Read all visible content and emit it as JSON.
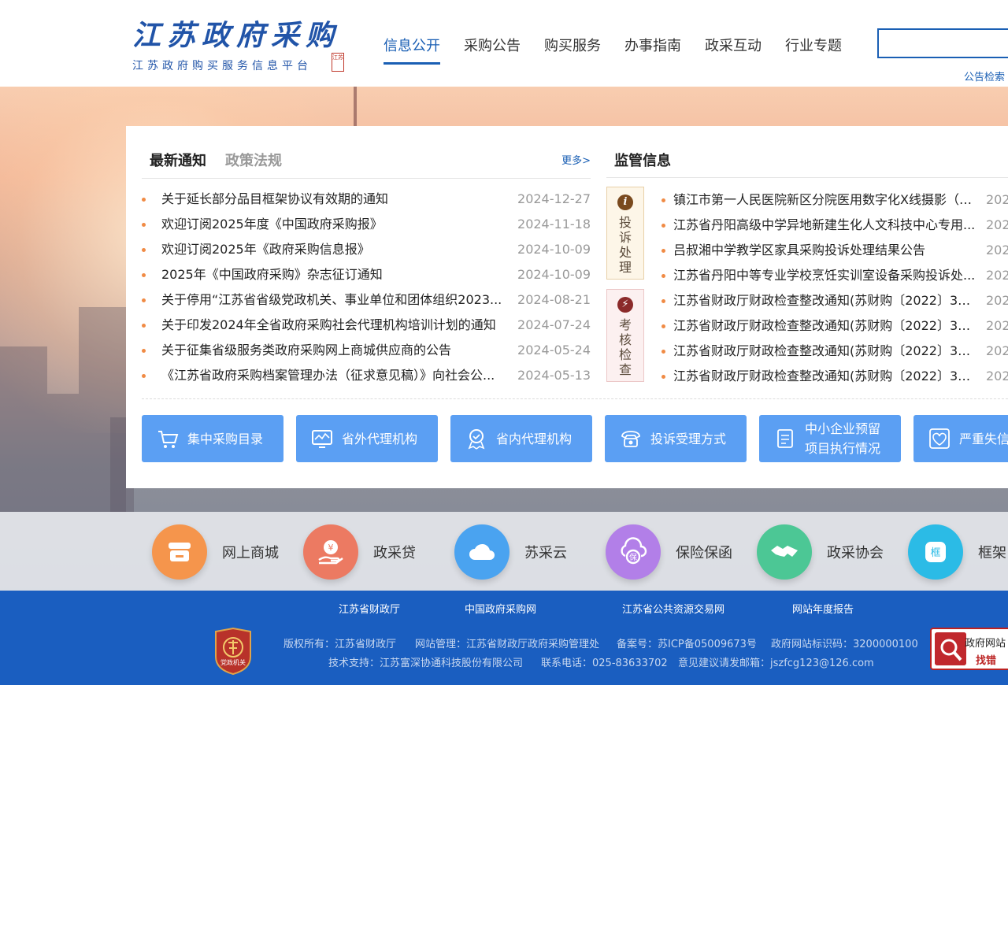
{
  "header": {
    "logo_title": "江苏政府采购",
    "logo_subtitle": "江苏政府购买服务信息平台",
    "logo_seal": "江苏",
    "nav": [
      {
        "label": "信息公开",
        "active": true
      },
      {
        "label": "采购公告"
      },
      {
        "label": "购买服务"
      },
      {
        "label": "办事指南"
      },
      {
        "label": "政采互动"
      },
      {
        "label": "行业专题"
      }
    ],
    "search": {
      "value": "",
      "placeholder": ""
    },
    "search_link": "公告检索"
  },
  "notice": {
    "tab_latest": "最新通知",
    "tab_policy": "政策法规",
    "more": "更多>",
    "items": [
      {
        "title": "关于延长部分品目框架协议有效期的通知",
        "date": "2024-12-27"
      },
      {
        "title": "欢迎订阅2025年度《中国政府采购报》",
        "date": "2024-11-18"
      },
      {
        "title": "欢迎订阅2025年《政府采购信息报》",
        "date": "2024-10-09"
      },
      {
        "title": "2025年《中国政府采购》杂志征订通知",
        "date": "2024-10-09"
      },
      {
        "title": "关于停用“江苏省省级党政机关、事业单位和团体组织2023...",
        "date": "2024-08-21"
      },
      {
        "title": "关于印发2024年全省政府采购社会代理机构培训计划的通知",
        "date": "2024-07-24"
      },
      {
        "title": "关于征集省级服务类政府采购网上商城供应商的公告",
        "date": "2024-05-24"
      },
      {
        "title": "《江苏省政府采购档案管理办法（征求意见稿）》向社会公...",
        "date": "2024-05-13"
      }
    ]
  },
  "supervise": {
    "title": "监管信息",
    "box_complaint": {
      "icon_char": "i",
      "label": "投诉处理"
    },
    "box_exam": {
      "icon_char": "⚡",
      "label": "考核检查"
    },
    "items": [
      {
        "title": "镇江市第一人民医院新区分院医用数字化X线摄影（D...",
        "date": "202"
      },
      {
        "title": "江苏省丹阳高级中学异地新建生化人文科技中心专用...",
        "date": "202"
      },
      {
        "title": "吕叔湘中学教学区家具采购投诉处理结果公告",
        "date": "202"
      },
      {
        "title": "江苏省丹阳中等专业学校烹饪实训室设备采购投诉处...",
        "date": "202"
      },
      {
        "title": "江苏省财政厅财政检查整改通知(苏财购〔2022〕37号)",
        "date": "202"
      },
      {
        "title": "江苏省财政厅财政检查整改通知(苏财购〔2022〕36号)",
        "date": "202"
      },
      {
        "title": "江苏省财政厅财政检查整改通知(苏财购〔2022〕35号)",
        "date": "202"
      },
      {
        "title": "江苏省财政厅财政检查整改通知(苏财购〔2022〕33号)",
        "date": "202"
      }
    ]
  },
  "quick_links": [
    {
      "label": "集中采购目录",
      "icon": "cart-icon"
    },
    {
      "label": "省外代理机构",
      "icon": "monitor-icon"
    },
    {
      "label": "省内代理机构",
      "icon": "badge-icon"
    },
    {
      "label": "投诉受理方式",
      "icon": "phone-icon"
    },
    {
      "label": "中小企业预留项目执行情况",
      "line1": "中小企业预留",
      "line2": "项目执行情况",
      "icon": "document-icon"
    },
    {
      "label": "严重失信",
      "icon": "heart-icon"
    }
  ],
  "services": [
    {
      "label": "网上商城",
      "icon": "shop-icon",
      "color": "#f5954c"
    },
    {
      "label": "政采贷",
      "icon": "loan-icon",
      "color": "#ec7a62"
    },
    {
      "label": "苏采云",
      "icon": "cloud-icon",
      "color": "#4aa3f0"
    },
    {
      "label": "保险保函",
      "icon": "insurance-icon",
      "color": "#b27fe8"
    },
    {
      "label": "政采协会",
      "icon": "handshake-icon",
      "color": "#4cc795"
    },
    {
      "label": "框架",
      "icon": "frame-icon",
      "color": "#2bbbe6",
      "glyph": "框"
    }
  ],
  "footer": {
    "links": [
      "江苏省财政厅",
      "中国政府采购网",
      "江苏省公共资源交易网",
      "网站年度报告"
    ],
    "copyright": "版权所有：江苏省财政厅",
    "admin": "网站管理：江苏省财政厅政府采购管理处",
    "icp": "备案号：苏ICP备05009673号",
    "site_id": "政府网站标识码：3200000100",
    "support": "技术支持：江苏富深协通科技股份有限公司",
    "phone": "联系电话：025-83633702",
    "email": "意见建议请发邮箱：jszfcg123@126.com",
    "emblem_text": "党政机关",
    "badge_line1": "政府网站",
    "badge_line2": "找错"
  },
  "colors": {
    "brand": "#1a5fb4",
    "quick_button": "#5b9ff3",
    "footer": "#1a5ec0",
    "bullet": "#f08b45"
  }
}
